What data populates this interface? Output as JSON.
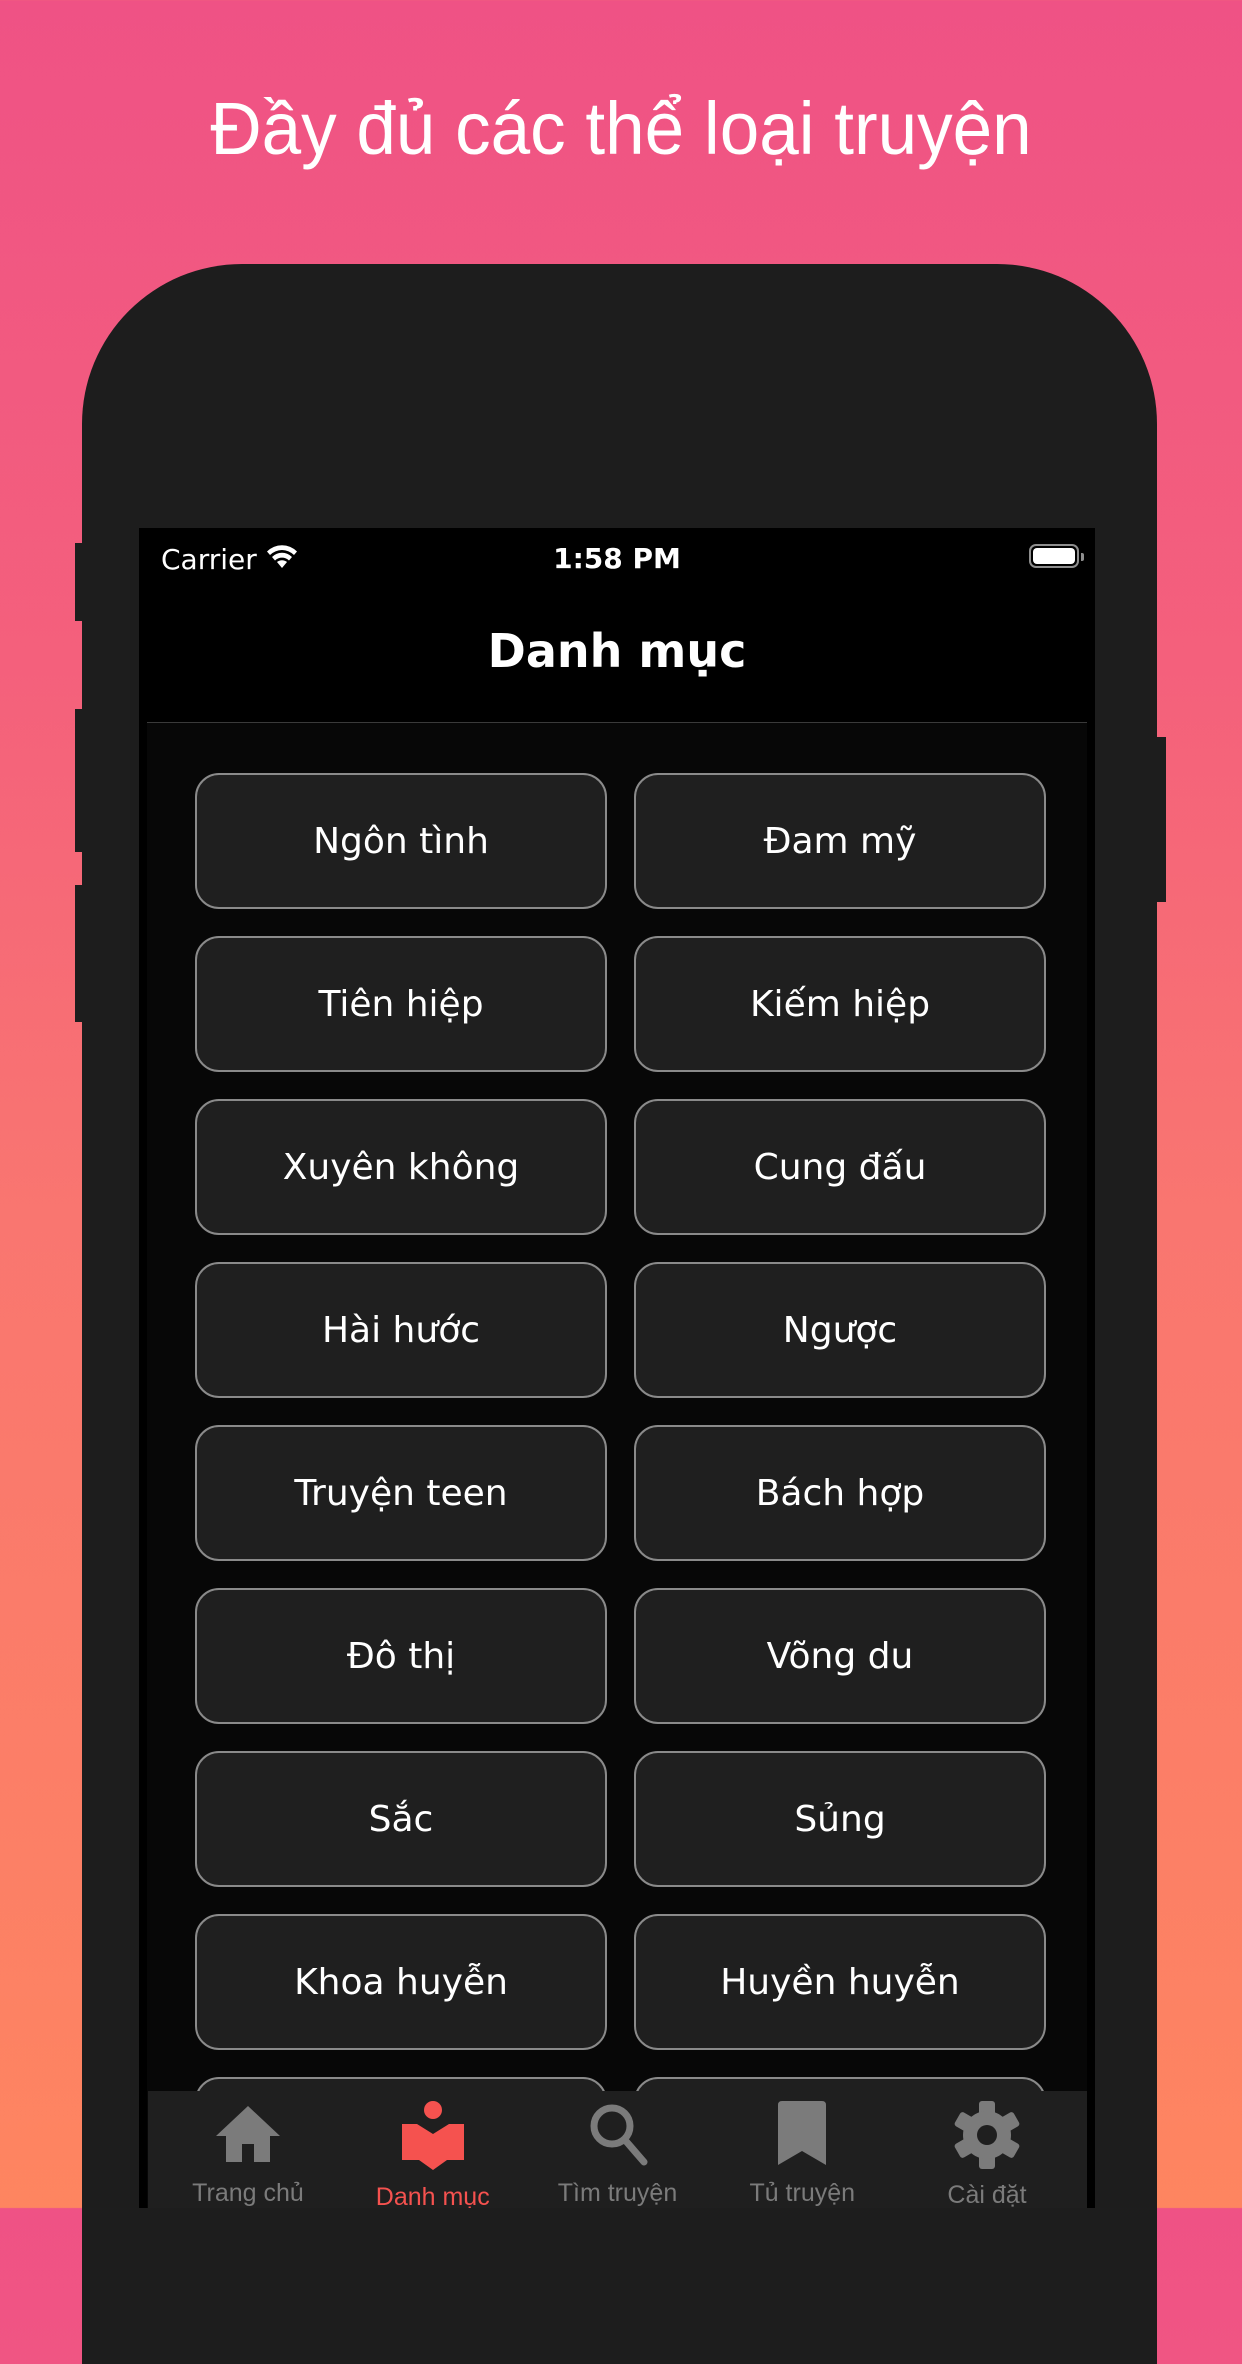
{
  "headline": "Đầy đủ các thể loại truyện",
  "status_bar": {
    "carrier": "Carrier",
    "time": "1:58 PM",
    "wifi_icon": "wifi-icon",
    "battery_icon": "battery-full-icon"
  },
  "nav": {
    "title": "Danh mục"
  },
  "categories": [
    {
      "label": "Ngôn tình"
    },
    {
      "label": "Đam mỹ"
    },
    {
      "label": "Tiên hiệp"
    },
    {
      "label": "Kiếm hiệp"
    },
    {
      "label": "Xuyên không"
    },
    {
      "label": "Cung đấu"
    },
    {
      "label": "Hài hước"
    },
    {
      "label": "Ngược"
    },
    {
      "label": "Truyện teen"
    },
    {
      "label": "Bách hợp"
    },
    {
      "label": "Đô thị"
    },
    {
      "label": "Võng du"
    },
    {
      "label": "Sắc"
    },
    {
      "label": "Sủng"
    },
    {
      "label": "Khoa huyễn"
    },
    {
      "label": "Huyền huyễn"
    },
    {
      "label": ""
    },
    {
      "label": ""
    }
  ],
  "tab_bar": {
    "tabs": [
      {
        "label": "Trang chủ",
        "icon": "home-icon",
        "active": false
      },
      {
        "label": "Danh mục",
        "icon": "book-reader-icon",
        "active": true
      },
      {
        "label": "Tìm truyện",
        "icon": "search-icon",
        "active": false
      },
      {
        "label": "Tủ truyện",
        "icon": "bookmark-icon",
        "active": false
      },
      {
        "label": "Cài đặt",
        "icon": "gear-icon",
        "active": false
      }
    ]
  },
  "colors": {
    "active_tab": "#f5524f",
    "inactive_tab": "#7b7b7b",
    "gradient_top": "#ef5285",
    "gradient_bottom": "#fe8560",
    "button_border": "#8a8a8a",
    "button_fill": "#1f1f1f"
  }
}
